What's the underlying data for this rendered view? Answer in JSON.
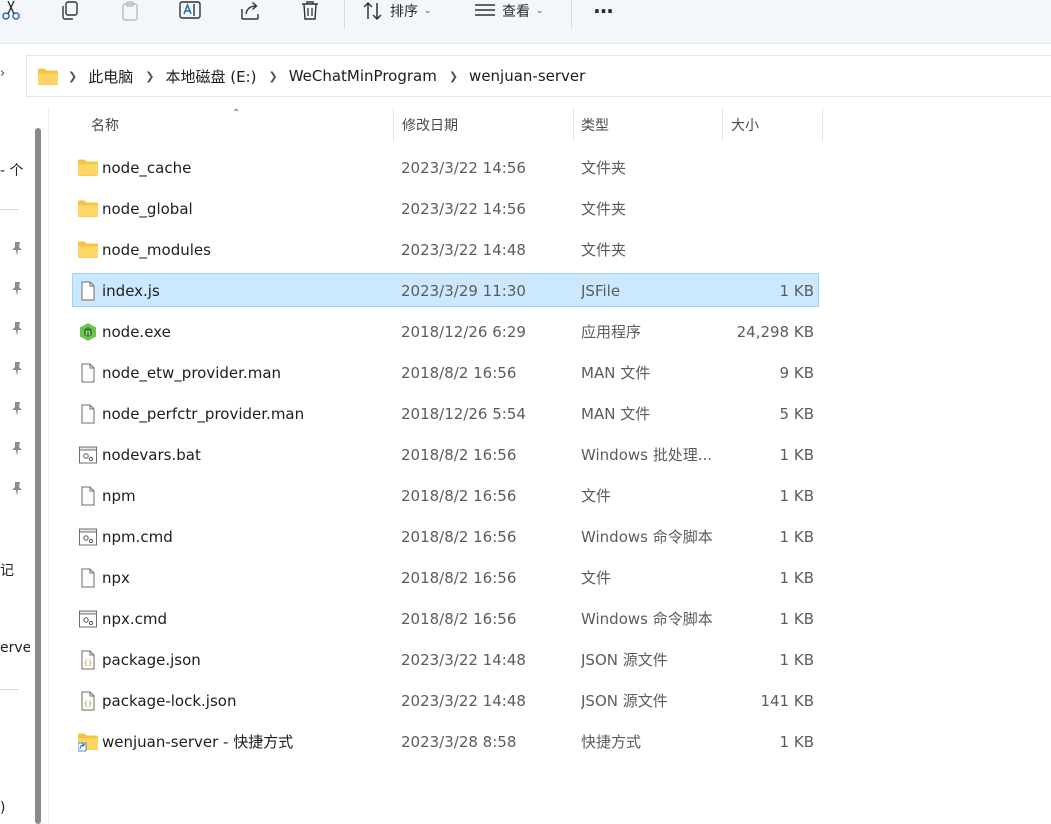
{
  "toolbar": {
    "sort_label": "排序",
    "view_label": "查看",
    "more_label": "···"
  },
  "address": {
    "crumbs": [
      "此电脑",
      "本地磁盘 (E:)",
      "WeChatMinProgram",
      "wenjuan-server"
    ]
  },
  "left_pane": {
    "texts": [
      "- 个",
      "记",
      "erve",
      ")"
    ]
  },
  "columns": {
    "name": "名称",
    "modified": "修改日期",
    "type": "类型",
    "size": "大小"
  },
  "files": [
    {
      "name": "node_cache",
      "modified": "2023/3/22 14:56",
      "type": "文件夹",
      "size": "",
      "icon": "folder-icon"
    },
    {
      "name": "node_global",
      "modified": "2023/3/22 14:56",
      "type": "文件夹",
      "size": "",
      "icon": "folder-icon"
    },
    {
      "name": "node_modules",
      "modified": "2023/3/22 14:48",
      "type": "文件夹",
      "size": "",
      "icon": "folder-icon"
    },
    {
      "name": "index.js",
      "modified": "2023/3/29 11:30",
      "type": "JSFile",
      "size": "1 KB",
      "icon": "file-icon",
      "selected": true
    },
    {
      "name": "node.exe",
      "modified": "2018/12/26 6:29",
      "type": "应用程序",
      "size": "24,298 KB",
      "icon": "nodejs-icon"
    },
    {
      "name": "node_etw_provider.man",
      "modified": "2018/8/2 16:56",
      "type": "MAN 文件",
      "size": "9 KB",
      "icon": "file-icon"
    },
    {
      "name": "node_perfctr_provider.man",
      "modified": "2018/12/26 5:54",
      "type": "MAN 文件",
      "size": "5 KB",
      "icon": "file-icon"
    },
    {
      "name": "nodevars.bat",
      "modified": "2018/8/2 16:56",
      "type": "Windows 批处理...",
      "size": "1 KB",
      "icon": "batch-file-icon"
    },
    {
      "name": "npm",
      "modified": "2018/8/2 16:56",
      "type": "文件",
      "size": "1 KB",
      "icon": "file-icon"
    },
    {
      "name": "npm.cmd",
      "modified": "2018/8/2 16:56",
      "type": "Windows 命令脚本",
      "size": "1 KB",
      "icon": "batch-file-icon"
    },
    {
      "name": "npx",
      "modified": "2018/8/2 16:56",
      "type": "文件",
      "size": "1 KB",
      "icon": "file-icon"
    },
    {
      "name": "npx.cmd",
      "modified": "2018/8/2 16:56",
      "type": "Windows 命令脚本",
      "size": "1 KB",
      "icon": "batch-file-icon"
    },
    {
      "name": "package.json",
      "modified": "2023/3/22 14:48",
      "type": "JSON 源文件",
      "size": "1 KB",
      "icon": "json-file-icon"
    },
    {
      "name": "package-lock.json",
      "modified": "2023/3/22 14:48",
      "type": "JSON 源文件",
      "size": "141 KB",
      "icon": "json-file-icon"
    },
    {
      "name": "wenjuan-server - 快捷方式",
      "modified": "2023/3/28 8:58",
      "type": "快捷方式",
      "size": "1 KB",
      "icon": "folder-shortcut-icon"
    }
  ]
}
